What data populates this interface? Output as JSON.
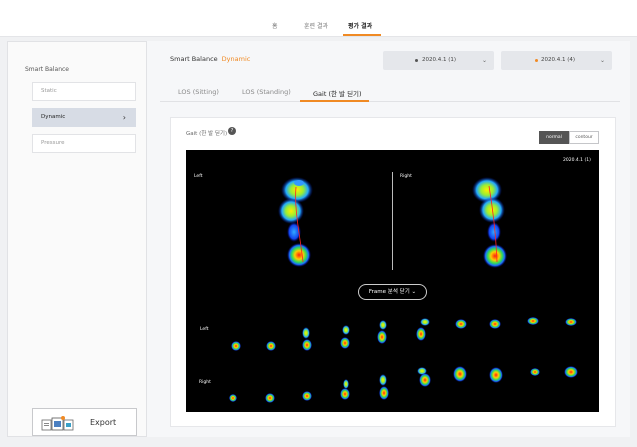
{
  "nav": {
    "tabs": [
      {
        "label": "홈"
      },
      {
        "label": "훈련 결과"
      },
      {
        "label": "평가 결과"
      }
    ]
  },
  "sidebar": {
    "title": "Smart Balance",
    "items": [
      {
        "label": "Static"
      },
      {
        "label": "Dynamic"
      },
      {
        "label": "Pressure"
      }
    ],
    "export_label": "Export"
  },
  "main": {
    "title": "Smart Balance",
    "title_accent": "Dynamic",
    "dropdowns": [
      {
        "label": "2020.4.1 (1)",
        "dot_color": "#555555"
      },
      {
        "label": "2020.4.1 (4)",
        "dot_color": "#f08a24"
      }
    ],
    "tabs": [
      {
        "label": "LOS (Sitting)"
      },
      {
        "label": "LOS (Standing)"
      },
      {
        "label": "Gait (한 발 딛기)"
      }
    ]
  },
  "card": {
    "title": "Gait (한 발 딛기)",
    "help": "?",
    "toggle": {
      "normal": "normal",
      "contour": "contour"
    },
    "viewer": {
      "date": "2020.4.1 (1)",
      "left_label": "Left",
      "right_label": "Right",
      "frame_button": "Frame 분석 닫기",
      "row_left": "Left",
      "row_right": "Right"
    }
  },
  "colors": {
    "accent": "#f08a24",
    "active_sidebar": "#d7dce5",
    "viewer_bg": "#000000"
  }
}
